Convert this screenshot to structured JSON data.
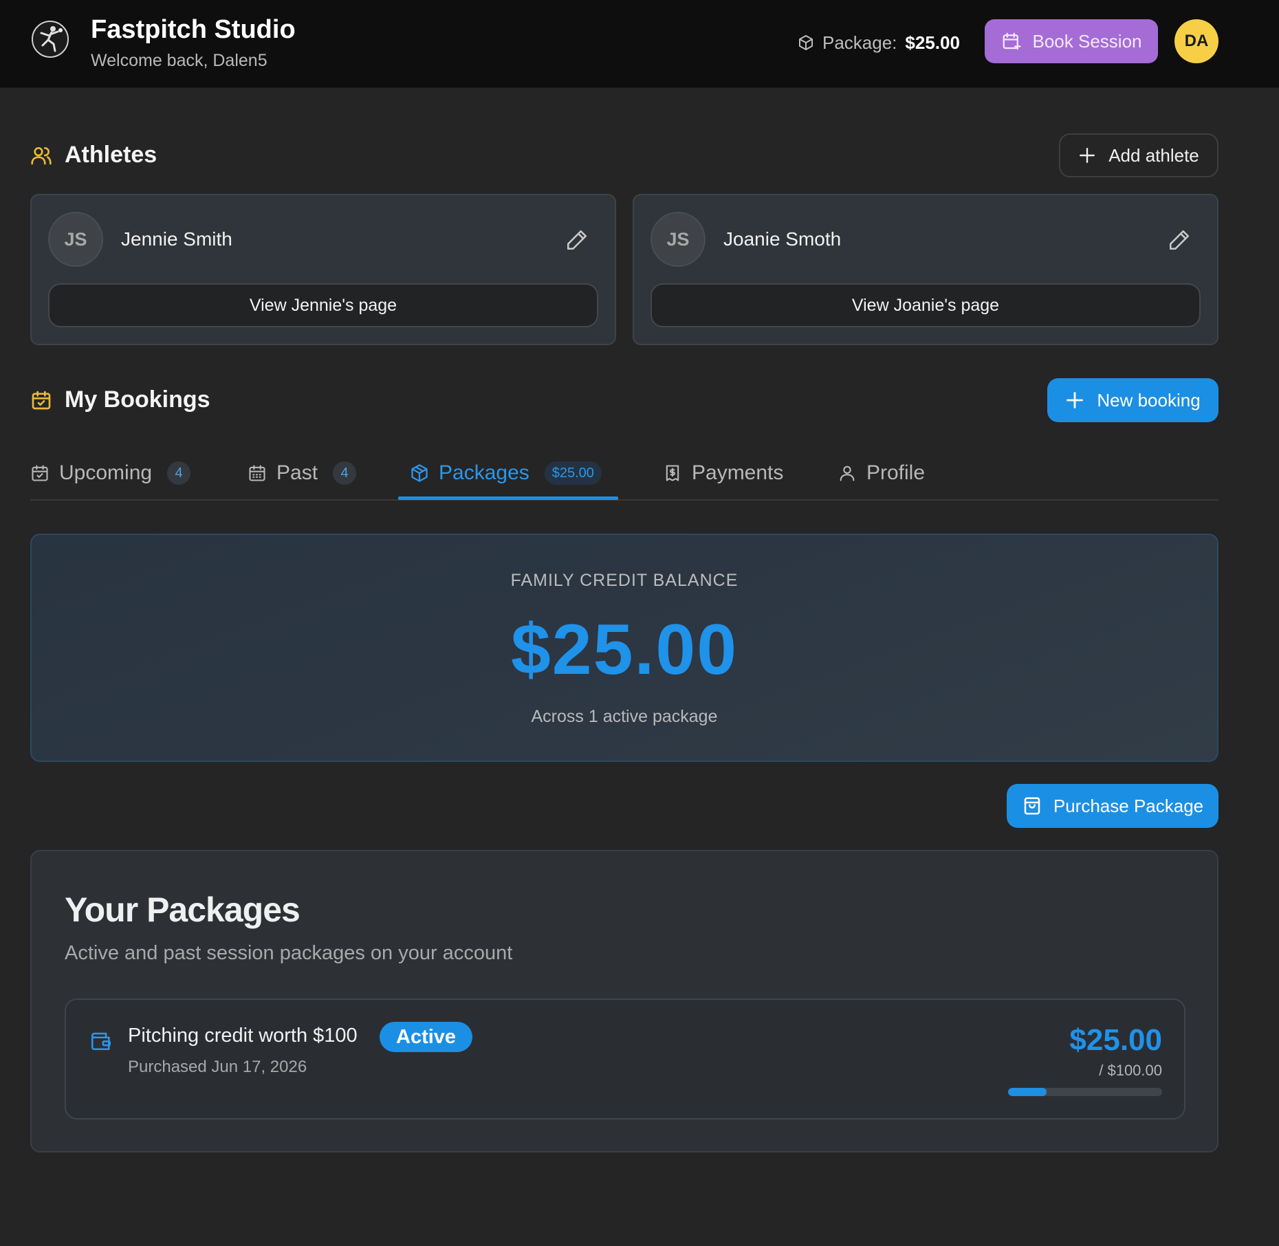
{
  "header": {
    "brand_title": "Fastpitch Studio",
    "welcome": "Welcome back, Dalen5",
    "package_label": "Package:",
    "package_value": "$25.00",
    "book_session_label": "Book Session",
    "user_initials": "DA"
  },
  "athletes": {
    "title": "Athletes",
    "add_label": "Add athlete",
    "items": [
      {
        "initials": "JS",
        "name": "Jennie Smith",
        "view_label": "View Jennie's page"
      },
      {
        "initials": "JS",
        "name": "Joanie Smoth",
        "view_label": "View Joanie's page"
      }
    ]
  },
  "bookings": {
    "title": "My Bookings",
    "new_label": "New booking",
    "tabs": [
      {
        "label": "Upcoming",
        "badge": "4",
        "icon": "calendar-check-icon"
      },
      {
        "label": "Past",
        "badge": "4",
        "icon": "calendar-grid-icon"
      },
      {
        "label": "Packages",
        "badge": "$25.00",
        "icon": "package-icon",
        "active": true
      },
      {
        "label": "Payments",
        "icon": "receipt-icon"
      },
      {
        "label": "Profile",
        "icon": "user-icon"
      }
    ]
  },
  "credit": {
    "label": "FAMILY CREDIT BALANCE",
    "amount": "$25.00",
    "sub": "Across 1 active package"
  },
  "purchase_label": "Purchase Package",
  "your_packages": {
    "title": "Your Packages",
    "subtitle": "Active and past session packages on your account",
    "items": [
      {
        "name": "Pitching credit worth $100",
        "status": "Active",
        "purchased": "Purchased Jun 17, 2026",
        "remaining": "$25.00",
        "total": "/ $100.00",
        "progress": 0.25
      }
    ]
  },
  "colors": {
    "accent_blue": "#1b8fe3",
    "accent_purple": "#a56cd6",
    "accent_yellow": "#f6cf47"
  }
}
